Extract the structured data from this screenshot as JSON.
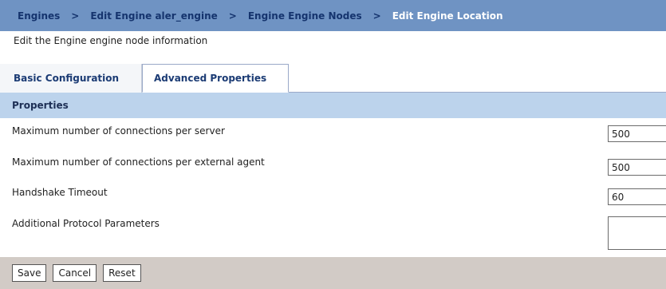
{
  "breadcrumb": {
    "items": [
      {
        "label": "Engines"
      },
      {
        "label": "Edit Engine aler_engine"
      },
      {
        "label": "Engine Engine Nodes"
      },
      {
        "label": "Edit Engine Location"
      }
    ],
    "separator": ">"
  },
  "page": {
    "description": "Edit the Engine engine node information"
  },
  "tabs": [
    {
      "label": "Basic Configuration",
      "active": false
    },
    {
      "label": "Advanced Properties",
      "active": true
    }
  ],
  "properties": {
    "header": "Properties",
    "rows": [
      {
        "label": "Maximum number of connections per server",
        "value": "500"
      },
      {
        "label": "Maximum number of connections per external agent",
        "value": "500"
      },
      {
        "label": "Handshake Timeout",
        "value": "60"
      },
      {
        "label": "Additional Protocol Parameters",
        "value": ""
      }
    ]
  },
  "buttons": {
    "save": "Save",
    "cancel": "Cancel",
    "reset": "Reset"
  },
  "colors": {
    "breadcrumb_bg": "#6f93c3",
    "breadcrumb_link": "#15346e",
    "header_bg": "#bcd3ec",
    "footer_bg": "#d2cbc6"
  }
}
